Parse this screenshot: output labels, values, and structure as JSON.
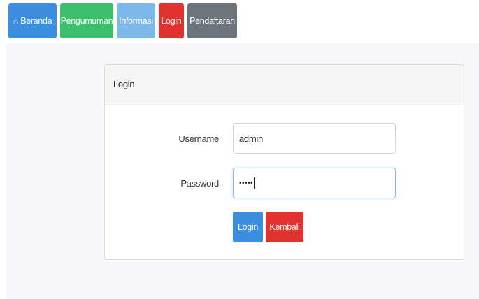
{
  "nav": {
    "items": [
      {
        "label": "Beranda",
        "icon": "home-icon",
        "color": "#3b8fde"
      },
      {
        "label": "Pengumuman",
        "color": "#3cbf6a"
      },
      {
        "label": "Informasi",
        "color": "#7db8ea"
      },
      {
        "label": "Login",
        "color": "#e0322f"
      },
      {
        "label": "Pendaftaran",
        "color": "#6c757d"
      }
    ]
  },
  "login_card": {
    "title": "Login",
    "username_label": "Username",
    "username_value": "admin",
    "password_label": "Password",
    "password_value": "•••••",
    "login_button": "Login",
    "back_button": "Kembali"
  },
  "colors": {
    "primary": "#3b8fde",
    "danger": "#e0322f"
  }
}
